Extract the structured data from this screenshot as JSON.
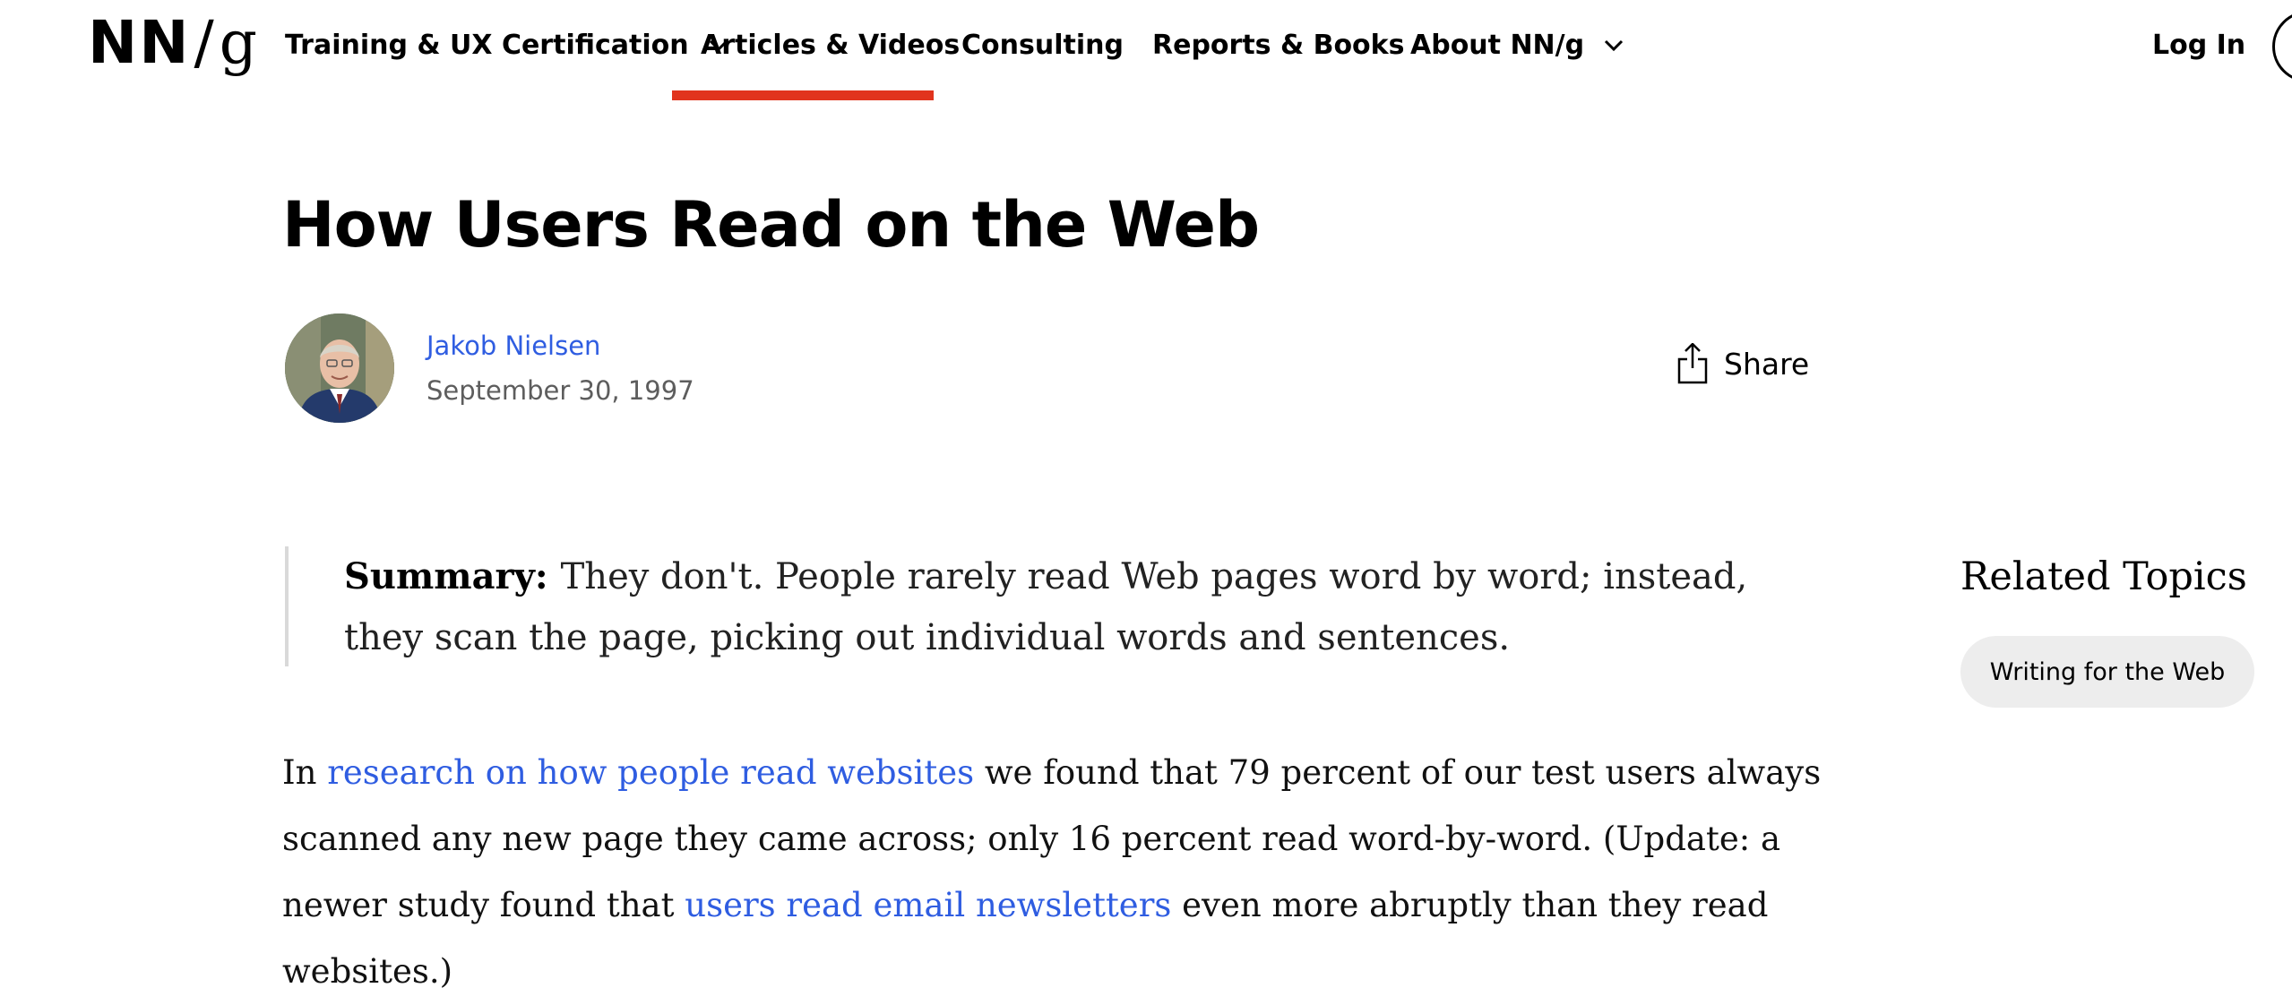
{
  "header": {
    "logo": {
      "nn": "NN",
      "slash": "/",
      "g": "g"
    },
    "nav": [
      {
        "label": "Training & UX Certification",
        "has_dropdown": true
      },
      {
        "label": "Articles & Videos",
        "active": true
      },
      {
        "label": "Consulting"
      },
      {
        "label": "Reports & Books"
      },
      {
        "label": "About NN/g",
        "has_dropdown": true
      }
    ],
    "login_label": "Log In",
    "accent_color": "#e1341e"
  },
  "article": {
    "title": "How Users Read on the Web",
    "author": "Jakob Nielsen",
    "date": "September 30, 1997",
    "share_label": "Share",
    "summary_lead": "Summary:",
    "summary_text": "They don't. People rarely read Web pages word by word; instead, they scan the page, picking out individual words and sentences.",
    "body": {
      "t1": "In ",
      "link1": "research on how people read websites",
      "t2": " we found that 79 percent of our test users always scanned any new page they came across; only 16 percent read word-by-word. (Update: a newer study found that ",
      "link2": "users read email newsletters",
      "t3": " even more abruptly than they read websites.)"
    },
    "link_color": "#2f5de1"
  },
  "sidebar": {
    "related_title": "Related Topics",
    "topics": [
      "Writing for the Web"
    ]
  }
}
